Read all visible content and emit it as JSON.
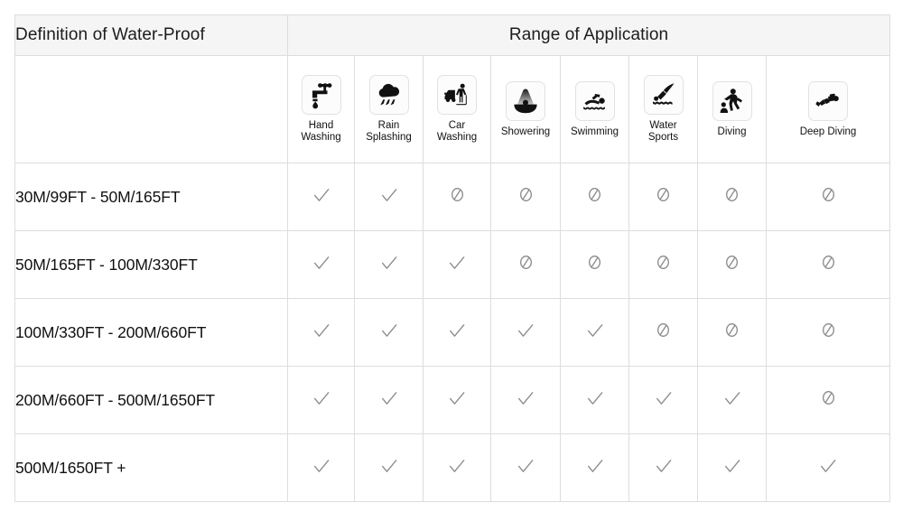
{
  "header": {
    "definition_title": "Definition of Water-Proof",
    "range_title": "Range of Application"
  },
  "columns": [
    {
      "icon": "faucet-icon",
      "label": "Hand\nWashing",
      "label_line1": "Hand",
      "label_line2": "Washing"
    },
    {
      "icon": "rain-cloud-icon",
      "label": "Rain\nSplashing",
      "label_line1": "Rain",
      "label_line2": "Splashing"
    },
    {
      "icon": "car-wash-icon",
      "label": "Car\nWashing",
      "label_line1": "Car",
      "label_line2": "Washing"
    },
    {
      "icon": "shower-icon",
      "label": "Showering",
      "label_line1": "Showering",
      "label_line2": ""
    },
    {
      "icon": "swimmer-icon",
      "label": "Swimming",
      "label_line1": "Swimming",
      "label_line2": ""
    },
    {
      "icon": "water-sports-icon",
      "label": "Water\nSports",
      "label_line1": "Water",
      "label_line2": "Sports"
    },
    {
      "icon": "diving-icon",
      "label": "Diving",
      "label_line1": "Diving",
      "label_line2": ""
    },
    {
      "icon": "deep-diving-icon",
      "label": "Deep Diving",
      "label_line1": "Deep Diving",
      "label_line2": ""
    }
  ],
  "rows": [
    {
      "label": "30M/99FT   -  50M/165FT",
      "marks": [
        "check",
        "check",
        "no",
        "no",
        "no",
        "no",
        "no",
        "no"
      ]
    },
    {
      "label": "50M/165FT   -  100M/330FT",
      "marks": [
        "check",
        "check",
        "check",
        "no",
        "no",
        "no",
        "no",
        "no"
      ]
    },
    {
      "label": "100M/330FT   -  200M/660FT",
      "marks": [
        "check",
        "check",
        "check",
        "check",
        "check",
        "no",
        "no",
        "no"
      ]
    },
    {
      "label": "200M/660FT   -  500M/1650FT",
      "marks": [
        "check",
        "check",
        "check",
        "check",
        "check",
        "check",
        "check",
        "no"
      ]
    },
    {
      "label": "500M/1650FT  +",
      "marks": [
        "check",
        "check",
        "check",
        "check",
        "check",
        "check",
        "check",
        "check"
      ]
    }
  ],
  "marks_legend": {
    "check": "supported-check-mark",
    "no": "not-supported-prohibited-mark"
  },
  "colors": {
    "banner_bg": "#f5f5f5",
    "grid_line": "#dddddd",
    "text": "#111111",
    "mark_gray": "#8c8c8c",
    "icon_black": "#111111",
    "page_bg": "#ffffff"
  }
}
